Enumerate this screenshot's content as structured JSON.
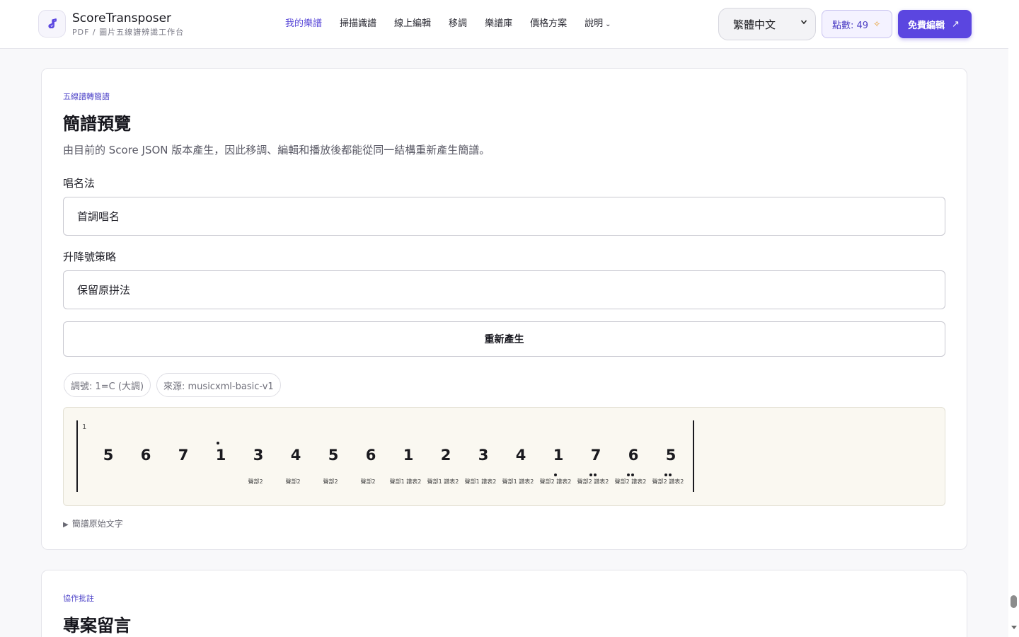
{
  "header": {
    "brand_name": "ScoreTransposer",
    "brand_sub": "PDF / 圖片五線譜辨識工作台",
    "nav": [
      {
        "label": "我的樂譜",
        "active": true
      },
      {
        "label": "掃描識譜",
        "active": false
      },
      {
        "label": "線上編輯",
        "active": false
      },
      {
        "label": "移調",
        "active": false
      },
      {
        "label": "樂譜庫",
        "active": false
      },
      {
        "label": "價格方案",
        "active": false
      },
      {
        "label": "說明",
        "active": false
      }
    ],
    "language": "繁體中文",
    "points_label": "點數: 49",
    "free_button": "免費編輯"
  },
  "preview_card": {
    "eyebrow": "五線譜轉簡譜",
    "title": "簡譜預覽",
    "description": "由目前的 Score JSON 版本產生，因此移調、編輯和播放後都能從同一結構重新產生簡譜。",
    "solfege_label": "唱名法",
    "solfege_value": "首調唱名",
    "accidental_label": "升降號策略",
    "accidental_value": "保留原拼法",
    "regenerate_button": "重新產生",
    "key_chip": "調號: 1=C (大調)",
    "source_chip": "來源: musicxml-basic-v1",
    "raw_text_toggle": "簡譜原始文字"
  },
  "score": {
    "measure_number": "1",
    "notes": [
      {
        "digit": "5",
        "above": 0,
        "below": 0,
        "label": ""
      },
      {
        "digit": "6",
        "above": 0,
        "below": 0,
        "label": ""
      },
      {
        "digit": "7",
        "above": 0,
        "below": 0,
        "label": ""
      },
      {
        "digit": "1",
        "above": 1,
        "below": 0,
        "label": ""
      },
      {
        "digit": "3",
        "above": 0,
        "below": 0,
        "label": "聲部2"
      },
      {
        "digit": "4",
        "above": 0,
        "below": 0,
        "label": "聲部2"
      },
      {
        "digit": "5",
        "above": 0,
        "below": 0,
        "label": "聲部2"
      },
      {
        "digit": "6",
        "above": 0,
        "below": 0,
        "label": "聲部2"
      },
      {
        "digit": "1",
        "above": 0,
        "below": 0,
        "label": "聲部1 譜表2"
      },
      {
        "digit": "2",
        "above": 0,
        "below": 0,
        "label": "聲部1 譜表2"
      },
      {
        "digit": "3",
        "above": 0,
        "below": 0,
        "label": "聲部1 譜表2"
      },
      {
        "digit": "4",
        "above": 0,
        "below": 0,
        "label": "聲部1 譜表2"
      },
      {
        "digit": "1",
        "above": 0,
        "below": 1,
        "label": "聲部2 譜表2"
      },
      {
        "digit": "7",
        "above": 0,
        "below": 2,
        "label": "聲部2 譜表2"
      },
      {
        "digit": "6",
        "above": 0,
        "below": 2,
        "label": "聲部2 譜表2"
      },
      {
        "digit": "5",
        "above": 0,
        "below": 2,
        "label": "聲部2 譜表2"
      }
    ]
  },
  "comments_card": {
    "eyebrow": "協作批註",
    "title": "專案留言"
  },
  "colors": {
    "accent": "#5b46e0",
    "score_background": "#faf8f1"
  }
}
